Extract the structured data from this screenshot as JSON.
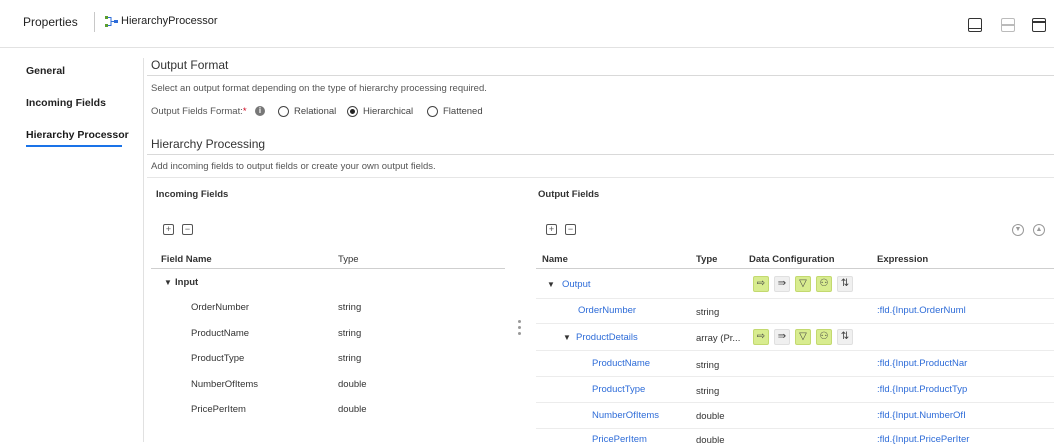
{
  "header": {
    "title": "Properties",
    "processor_name": "HierarchyProcessor"
  },
  "nav": {
    "items": [
      {
        "label": "General"
      },
      {
        "label": "Incoming Fields"
      },
      {
        "label": "Hierarchy Processor"
      }
    ],
    "active": "Hierarchy Processor"
  },
  "output_format": {
    "title": "Output Format",
    "description": "Select an output format depending on the type of hierarchy processing required.",
    "field_label": "Output Fields Format:",
    "required_mark": "*",
    "options": [
      "Relational",
      "Hierarchical",
      "Flattened"
    ],
    "selected": "Hierarchical"
  },
  "hierarchy": {
    "title": "Hierarchy Processing",
    "description": "Add incoming fields to output fields or create your own output fields."
  },
  "incoming": {
    "title": "Incoming Fields",
    "columns": [
      "Field Name",
      "Type"
    ],
    "group": "Input",
    "rows": [
      {
        "name": "OrderNumber",
        "type": "string"
      },
      {
        "name": "ProductName",
        "type": "string"
      },
      {
        "name": "ProductType",
        "type": "string"
      },
      {
        "name": "NumberOfItems",
        "type": "double"
      },
      {
        "name": "PricePerItem",
        "type": "double"
      }
    ]
  },
  "output": {
    "title": "Output Fields",
    "columns": [
      "Name",
      "Type",
      "Data Configuration",
      "Expression"
    ],
    "rows": [
      {
        "name": "Output",
        "type": "",
        "expression": ""
      },
      {
        "name": "OrderNumber",
        "type": "string",
        "expression": ":fld.{Input.OrderNuml"
      },
      {
        "name": "ProductDetails",
        "type": "array (Pr...",
        "expression": ""
      },
      {
        "name": "ProductName",
        "type": "string",
        "expression": ":fld.{Input.ProductNar"
      },
      {
        "name": "ProductType",
        "type": "string",
        "expression": ":fld.{Input.ProductTyp"
      },
      {
        "name": "NumberOfItems",
        "type": "double",
        "expression": ":fld.{Input.NumberOfI"
      },
      {
        "name": "PricePerItem",
        "type": "double",
        "expression": ":fld.{Input.PricePerIter"
      }
    ]
  },
  "colors": {
    "accent": "#1a73e8",
    "link": "#2e6cd8",
    "data_config_btn": "#d8ec8f"
  }
}
